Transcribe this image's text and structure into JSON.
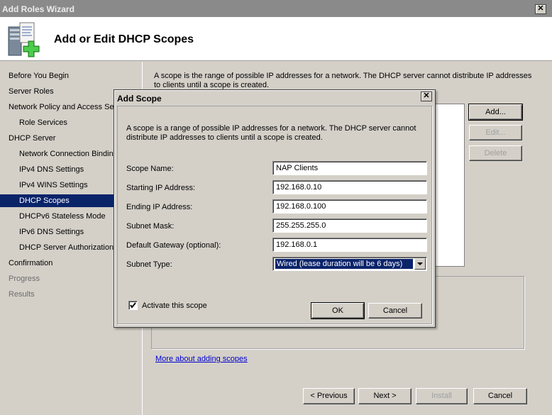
{
  "window": {
    "title": "Add Roles Wizard"
  },
  "header": {
    "title": "Add or Edit DHCP Scopes"
  },
  "nav": {
    "items": [
      {
        "label": "Before You Begin",
        "state": "normal",
        "indent": 0
      },
      {
        "label": "Server Roles",
        "state": "normal",
        "indent": 0
      },
      {
        "label": "Network Policy and Access Services",
        "state": "normal",
        "indent": 0
      },
      {
        "label": "Role Services",
        "state": "normal",
        "indent": 1
      },
      {
        "label": "DHCP Server",
        "state": "normal",
        "indent": 0
      },
      {
        "label": "Network Connection Bindings",
        "state": "normal",
        "indent": 1
      },
      {
        "label": "IPv4 DNS Settings",
        "state": "normal",
        "indent": 1
      },
      {
        "label": "IPv4 WINS Settings",
        "state": "normal",
        "indent": 1
      },
      {
        "label": "DHCP Scopes",
        "state": "active",
        "indent": 1
      },
      {
        "label": "DHCPv6 Stateless Mode",
        "state": "normal",
        "indent": 1
      },
      {
        "label": "IPv6 DNS Settings",
        "state": "normal",
        "indent": 1
      },
      {
        "label": "DHCP Server Authorization",
        "state": "normal",
        "indent": 1
      },
      {
        "label": "Confirmation",
        "state": "normal",
        "indent": 0
      },
      {
        "label": "Progress",
        "state": "dim",
        "indent": 0
      },
      {
        "label": "Results",
        "state": "dim",
        "indent": 0
      }
    ]
  },
  "main": {
    "description": "A scope is the range of possible IP addresses for a network. The DHCP server cannot distribute IP addresses to clients until a scope is created.",
    "buttons": {
      "add": "Add...",
      "edit": "Edit...",
      "delete": "Delete"
    },
    "more_link": "More about adding scopes"
  },
  "footer": {
    "previous": "< Previous",
    "next": "Next >",
    "install": "Install",
    "cancel": "Cancel"
  },
  "dialog": {
    "title": "Add Scope",
    "description": "A scope is a range of possible IP addresses for a network. The DHCP server cannot distribute IP addresses to clients until a scope is created.",
    "fields": {
      "scope_name": {
        "label": "Scope Name:",
        "value": "NAP Clients"
      },
      "starting_ip": {
        "label": "Starting IP Address:",
        "value": "192.168.0.10"
      },
      "ending_ip": {
        "label": "Ending IP Address:",
        "value": "192.168.0.100"
      },
      "subnet_mask": {
        "label": "Subnet Mask:",
        "value": "255.255.255.0"
      },
      "default_gateway": {
        "label": "Default Gateway (optional):",
        "value": "192.168.0.1"
      },
      "subnet_type": {
        "label": "Subnet Type:",
        "value": "Wired (lease duration will be 6 days)"
      }
    },
    "activate": {
      "label": "Activate this scope",
      "checked": true
    },
    "ok": "OK",
    "cancel": "Cancel"
  }
}
